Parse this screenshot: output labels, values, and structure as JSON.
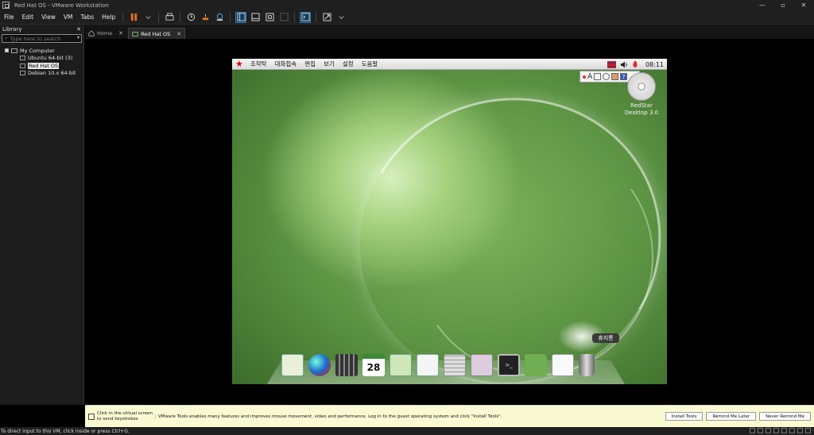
{
  "window": {
    "title": "Red Hat OS - VMware Workstation",
    "minimize": "—",
    "maximize": "▫",
    "close": "✕"
  },
  "menubar": {
    "items": [
      "File",
      "Edit",
      "View",
      "VM",
      "Tabs",
      "Help"
    ]
  },
  "library": {
    "title": "Library",
    "close": "✕",
    "search_placeholder": "Type here to search",
    "root": "My Computer",
    "vms": [
      "Ubuntu 64-bit (3)",
      "Red Hat OS",
      "Debian 10.x 64-bit"
    ],
    "selected_index": 1
  },
  "tabs": [
    {
      "label": "Home",
      "active": false
    },
    {
      "label": "Red Hat OS",
      "active": true
    }
  ],
  "guest": {
    "panel_menus": [
      "조작탁",
      "대화접속",
      "편집",
      "보기",
      "설정",
      "도움말"
    ],
    "clock": "08:11",
    "ime_letter": "A",
    "ime_help": "?",
    "disc_label_line1": "RedStar",
    "disc_label_line2": "Desktop 3.0",
    "trash_tooltip": "휴지통",
    "calendar_day": "28",
    "terminal_text": ">_"
  },
  "hint": {
    "left_text": "Click in the virtual screen to send keystrokes",
    "message": "VMware Tools enables many features and improves mouse movement, video and performance. Log in to the guest operating system and click \"Install Tools\".",
    "buttons": [
      "Install Tools",
      "Remind Me Later",
      "Never Remind Me"
    ]
  },
  "status": {
    "text": "To direct input to this VM, click inside or press Ctrl+G."
  },
  "colors": {
    "accent": "#2e7bb5",
    "pause": "#e8731d",
    "hint_bg": "#fafad2"
  }
}
